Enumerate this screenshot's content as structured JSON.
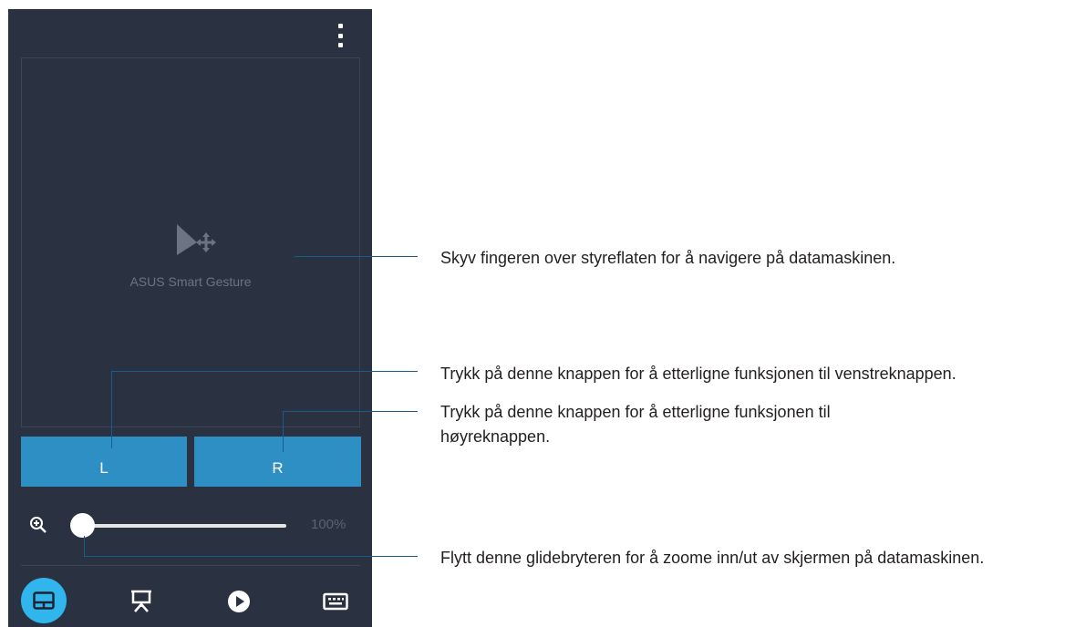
{
  "app": {
    "touchpad_label": "ASUS Smart Gesture",
    "left_button_label": "L",
    "right_button_label": "R",
    "zoom_value": "100%",
    "zoom_level_fraction": 0.0,
    "nav_items": [
      "touchpad-icon",
      "presentation-icon",
      "play-icon",
      "keyboard-icon"
    ],
    "active_nav": "touchpad-icon"
  },
  "callouts": {
    "touchpad": "Skyv fingeren over styreflaten for å navigere på datamaskinen.",
    "left_button": "Trykk på denne knappen for å etterligne funksjonen til venstreknappen.",
    "right_button_line1": "Trykk på denne knappen for å etterligne funksjonen til",
    "right_button_line2": "høyreknappen.",
    "slider": "Flytt denne glidebryteren for å zoome inn/ut av skjermen på datamaskinen."
  },
  "colors": {
    "panel_bg": "#2a3140",
    "button_blue": "#2e8fc5",
    "active_nav": "#30b5ec",
    "callout_line": "#1a5a8c"
  }
}
